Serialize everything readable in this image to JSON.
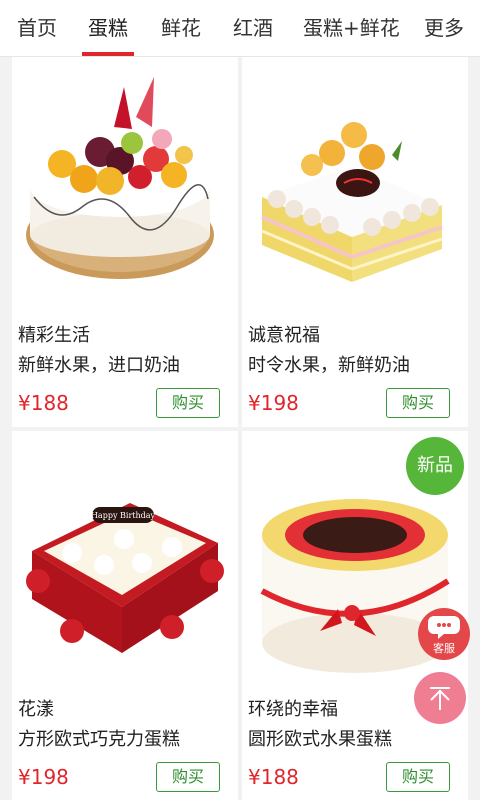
{
  "tabs": [
    {
      "label": "首页",
      "active": false
    },
    {
      "label": "蛋糕",
      "active": true
    },
    {
      "label": "鲜花",
      "active": false
    },
    {
      "label": "红酒",
      "active": false
    },
    {
      "label": "蛋糕+鲜花",
      "active": false
    },
    {
      "label": "更多",
      "active": false
    }
  ],
  "products": [
    {
      "title": "精彩生活",
      "desc": "新鲜水果，进口奶油",
      "price": "¥188",
      "buy_label": "购买",
      "image": "fruit-cake-icon"
    },
    {
      "title": "诚意祝福",
      "desc": "时令水果，新鲜奶油",
      "price": "¥198",
      "buy_label": "购买",
      "image": "layered-cake-icon"
    },
    {
      "title": "花漾",
      "desc": "方形欧式巧克力蛋糕",
      "price": "¥198",
      "buy_label": "购买",
      "image": "petal-cake-icon"
    },
    {
      "title": "环绕的幸福",
      "desc": "圆形欧式水果蛋糕",
      "price": "¥188",
      "buy_label": "购买",
      "image": "ribbon-cake-icon",
      "badge": "新品"
    }
  ],
  "cake_texts": {
    "happy_birthday": "Happy Birthday"
  },
  "floating": {
    "service_label": "客服",
    "top_icon": "arrow-up-icon"
  },
  "colors": {
    "accent_red": "#e0262d",
    "buy_green": "#3a9a3a",
    "badge_green": "#55b63a",
    "service_red": "#e4474a",
    "top_pink": "#f07e92"
  }
}
